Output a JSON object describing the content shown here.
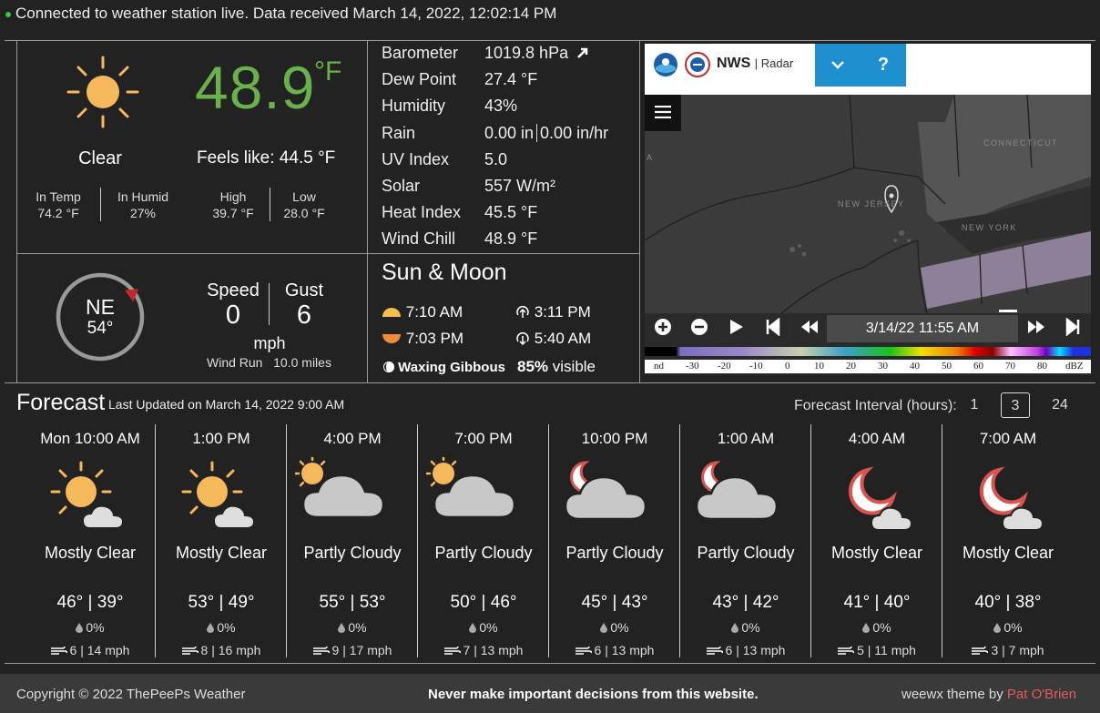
{
  "status": {
    "text": "Connected to weather station live. Data received March 14, 2022, 12:02:14 PM"
  },
  "current": {
    "temperature": "48.9",
    "unit": "°F",
    "condition": "Clear",
    "feels_like": "Feels like: 44.5 °F",
    "stats": [
      {
        "label": "In Temp",
        "value": "74.2 °F"
      },
      {
        "label": "In Humid",
        "value": "27%"
      },
      {
        "label": "High",
        "value": "39.7 °F"
      },
      {
        "label": "Low",
        "value": "28.0 °F"
      }
    ]
  },
  "observations": [
    {
      "label": "Barometer",
      "value": "1019.8 hPa",
      "trend": "up-right-arrow"
    },
    {
      "label": "Dew Point",
      "value": "27.4 °F"
    },
    {
      "label": "Humidity",
      "value": "43%"
    },
    {
      "label": "Rain",
      "value": "0.00 in",
      "value2": "0.00 in/hr"
    },
    {
      "label": "UV Index",
      "value": "5.0"
    },
    {
      "label": "Solar",
      "value": "557 W/m²"
    },
    {
      "label": "Heat Index",
      "value": "45.5 °F"
    },
    {
      "label": "Wind Chill",
      "value": "48.9 °F"
    }
  ],
  "wind": {
    "direction": "NE",
    "degrees": "54°",
    "speed_label": "Speed",
    "speed": "0",
    "gust_label": "Gust",
    "gust": "6",
    "unit": "mph",
    "run_label": "Wind Run",
    "run_value": "10.0 miles"
  },
  "sun_moon": {
    "title": "Sun & Moon",
    "sunrise": "7:10 AM",
    "sunset": "7:03 PM",
    "moonrise": "3:11 PM",
    "moonset": "5:40 AM",
    "phase": "Waxing Gibbous",
    "visible_pct": "85%",
    "visible_word": "visible"
  },
  "radar": {
    "brand": "NWS",
    "subtitle": "Radar",
    "timestamp": "3/14/22 11:55 AM",
    "map_labels": [
      "CONNECTICUT",
      "NEW JERSEY",
      "NEW YORK",
      "A"
    ],
    "scale_labels": [
      "nd",
      "-30",
      "-20",
      "-10",
      "0",
      "10",
      "20",
      "30",
      "40",
      "50",
      "60",
      "70",
      "80",
      "dBZ"
    ]
  },
  "forecast": {
    "title": "Forecast",
    "updated": "Last Updated on March 14, 2022 9:00 AM",
    "interval_label": "Forecast Interval (hours):",
    "intervals": [
      "1",
      "3",
      "24"
    ],
    "items": [
      {
        "time": "Mon 10:00 AM",
        "icon": "sun-small-cloud-icon",
        "condition": "Mostly Clear",
        "high": "46°",
        "low": "39°",
        "precip": "0%",
        "wind": "6 | 14 mph"
      },
      {
        "time": "1:00 PM",
        "icon": "sun-small-cloud-icon",
        "condition": "Mostly Clear",
        "high": "53°",
        "low": "49°",
        "precip": "0%",
        "wind": "8 | 16 mph"
      },
      {
        "time": "4:00 PM",
        "icon": "sun-cloud-icon",
        "condition": "Partly Cloudy",
        "high": "55°",
        "low": "53°",
        "precip": "0%",
        "wind": "9 | 17 mph"
      },
      {
        "time": "7:00 PM",
        "icon": "sun-cloud-icon",
        "condition": "Partly Cloudy",
        "high": "50°",
        "low": "46°",
        "precip": "0%",
        "wind": "7 | 13 mph"
      },
      {
        "time": "10:00 PM",
        "icon": "moon-cloud-icon",
        "condition": "Partly Cloudy",
        "high": "45°",
        "low": "43°",
        "precip": "0%",
        "wind": "6 | 13 mph"
      },
      {
        "time": "1:00 AM",
        "icon": "moon-cloud-icon",
        "condition": "Partly Cloudy",
        "high": "43°",
        "low": "42°",
        "precip": "0%",
        "wind": "6 | 13 mph"
      },
      {
        "time": "4:00 AM",
        "icon": "moon-small-cloud-icon",
        "condition": "Mostly Clear",
        "high": "41°",
        "low": "40°",
        "precip": "0%",
        "wind": "5 | 11 mph"
      },
      {
        "time": "7:00 AM",
        "icon": "moon-small-cloud-icon",
        "condition": "Mostly Clear",
        "high": "40°",
        "low": "38°",
        "precip": "0%",
        "wind": "3 | 7 mph"
      }
    ]
  },
  "footer": {
    "copyright": "Copyright © 2022 ThePeePs Weather",
    "warning": "Never make important decisions from this website.",
    "theme_prefix": "weewx theme by",
    "theme_author": "Pat O'Brien"
  },
  "colors": {
    "temperature": "#6ab04c",
    "sun": "#f5b85a",
    "moon_outline": "#d9534f",
    "cloud": "#c8c8c8",
    "radar_button": "#1e8fcf",
    "author_link": "#e35d5d"
  }
}
